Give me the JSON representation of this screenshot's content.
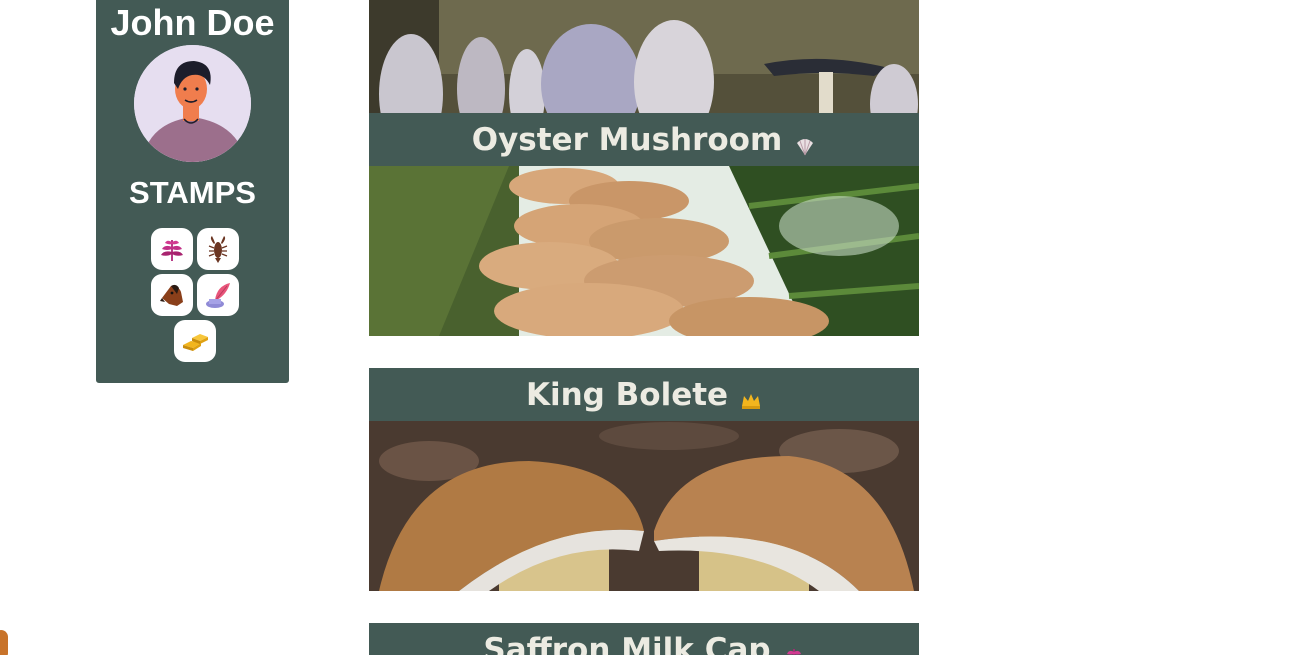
{
  "profile": {
    "name": "John Doe",
    "stamps_heading": "STAMPS",
    "stamps": [
      {
        "icon": "fern-leaf-icon"
      },
      {
        "icon": "lobster-icon"
      },
      {
        "icon": "dog-head-icon"
      },
      {
        "icon": "quill-inkwell-icon"
      },
      {
        "icon": "gold-bars-icon"
      }
    ]
  },
  "feed": {
    "cards": [
      {
        "title": "",
        "emoji": "",
        "image": "shaggy-ink-cap-mushrooms-photo"
      },
      {
        "title": "Oyster Mushroom",
        "emoji": "shell-icon",
        "image": "oyster-mushrooms-on-tree-photo"
      },
      {
        "title": "King Bolete",
        "emoji": "crown-icon",
        "image": "king-bolete-mushrooms-photo"
      },
      {
        "title": "Saffron Milk Cap",
        "emoji": "leaf-icon",
        "image": ""
      }
    ]
  },
  "colors": {
    "card_bg": "#435a55",
    "header_text": "#ecebe2",
    "stamp_bg": "#ffffff"
  }
}
